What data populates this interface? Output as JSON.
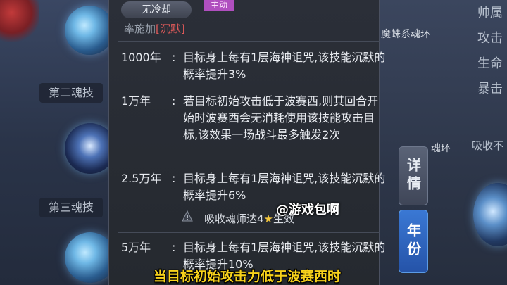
{
  "header": {
    "cooldown_pill": "无冷却",
    "type_tag": "主动"
  },
  "partial_line": {
    "text": "率施加",
    "tag": "[沉默]"
  },
  "rows": [
    {
      "year": "1000年",
      "colon": ":",
      "desc": "目标身上每有1层海神诅咒,该技能沉默的概率提升3%"
    },
    {
      "year": "1万年",
      "colon": ":",
      "desc": "若目标初始攻击低于波赛西,则其回合开始时波赛西会无消耗使用该技能攻击目标,该效果一场战斗最多触发2次"
    },
    {
      "year": "2.5万年",
      "colon": ":",
      "desc": "目标身上每有1层海神诅咒,该技能沉默的概率提升6%"
    },
    {
      "year": "5万年",
      "colon": ":",
      "desc": "目标身上每有1层海神诅咒,该技能沉默的概率提升10%"
    }
  ],
  "requirement": {
    "prefix": "吸收魂师达4",
    "star": "★",
    "suffix": "生效"
  },
  "left": {
    "soul_skill_2": "第二魂技",
    "soul_skill_3": "第三魂技"
  },
  "right": {
    "ring_1": "魔蛛系魂环",
    "ring_2": "魂环",
    "col": [
      "帅属",
      "攻击",
      "生命",
      "暴击",
      "吸收不"
    ]
  },
  "tabs": {
    "detail": "详情",
    "year": "年份"
  },
  "watermark": "@游戏包啊",
  "subtitle": "当目标初始攻击力低于波赛西时",
  "colors": {
    "accent_blue": "#2f6fcf",
    "silence_red": "#e05a5a",
    "subtitle_yellow": "#f7d21b",
    "tag_purple": "#b04fbf"
  }
}
